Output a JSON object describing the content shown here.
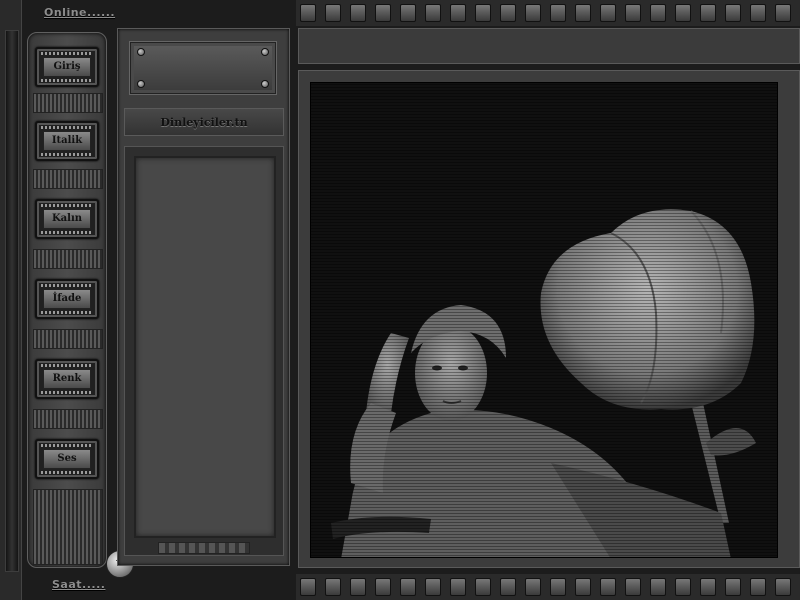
{
  "status": {
    "online_label": "Online......",
    "clock_label": "Saat....."
  },
  "menu": {
    "items": [
      {
        "label": "Giriş"
      },
      {
        "label": "Italik"
      },
      {
        "label": "Kalın"
      },
      {
        "label": "İfade"
      },
      {
        "label": "Renk"
      },
      {
        "label": "Ses"
      }
    ]
  },
  "users": {
    "title": "Dinleyiciler.tn"
  },
  "controls": {
    "scroll_up_glyph": "^",
    "scroll_up_icon": "chevron-up-icon"
  },
  "display": {
    "image_subject": "grayscale-woman-and-rose"
  },
  "colors": {
    "background": "#1c1c1c",
    "panel": "#3e3e3e",
    "text": "#8d8d8d"
  }
}
